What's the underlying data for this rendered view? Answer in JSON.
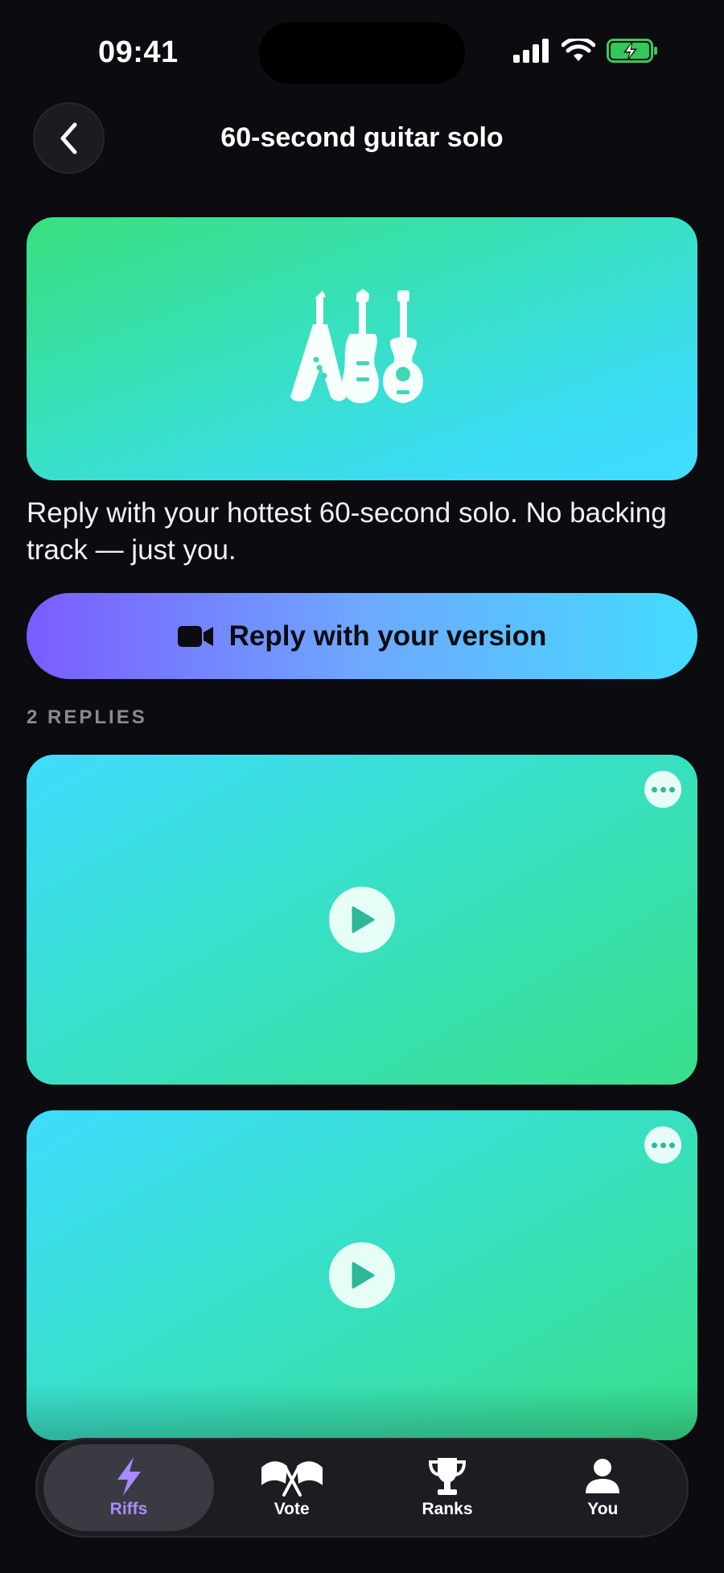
{
  "status": {
    "time": "09:41"
  },
  "nav": {
    "title": "60-second guitar solo"
  },
  "hero": {
    "icon": "guitars-icon",
    "gradient": [
      "#38e07e",
      "#40dcff"
    ]
  },
  "prompt": "Reply with your hottest 60-second solo. No backing track — just you.",
  "reply_button": {
    "label": "Reply with your version",
    "icon": "video-camera-icon"
  },
  "replies": {
    "count_label": "2 REPLIES",
    "items": [
      {
        "id": 1
      },
      {
        "id": 2
      }
    ]
  },
  "tabs": [
    {
      "label": "Riffs",
      "icon": "lightning-icon",
      "active": true
    },
    {
      "label": "Vote",
      "icon": "flags-icon",
      "active": false
    },
    {
      "label": "Ranks",
      "icon": "trophy-icon",
      "active": false
    },
    {
      "label": "You",
      "icon": "person-icon",
      "active": false
    }
  ],
  "colors": {
    "accent": "#a98bff",
    "background": "#0b0b10"
  }
}
